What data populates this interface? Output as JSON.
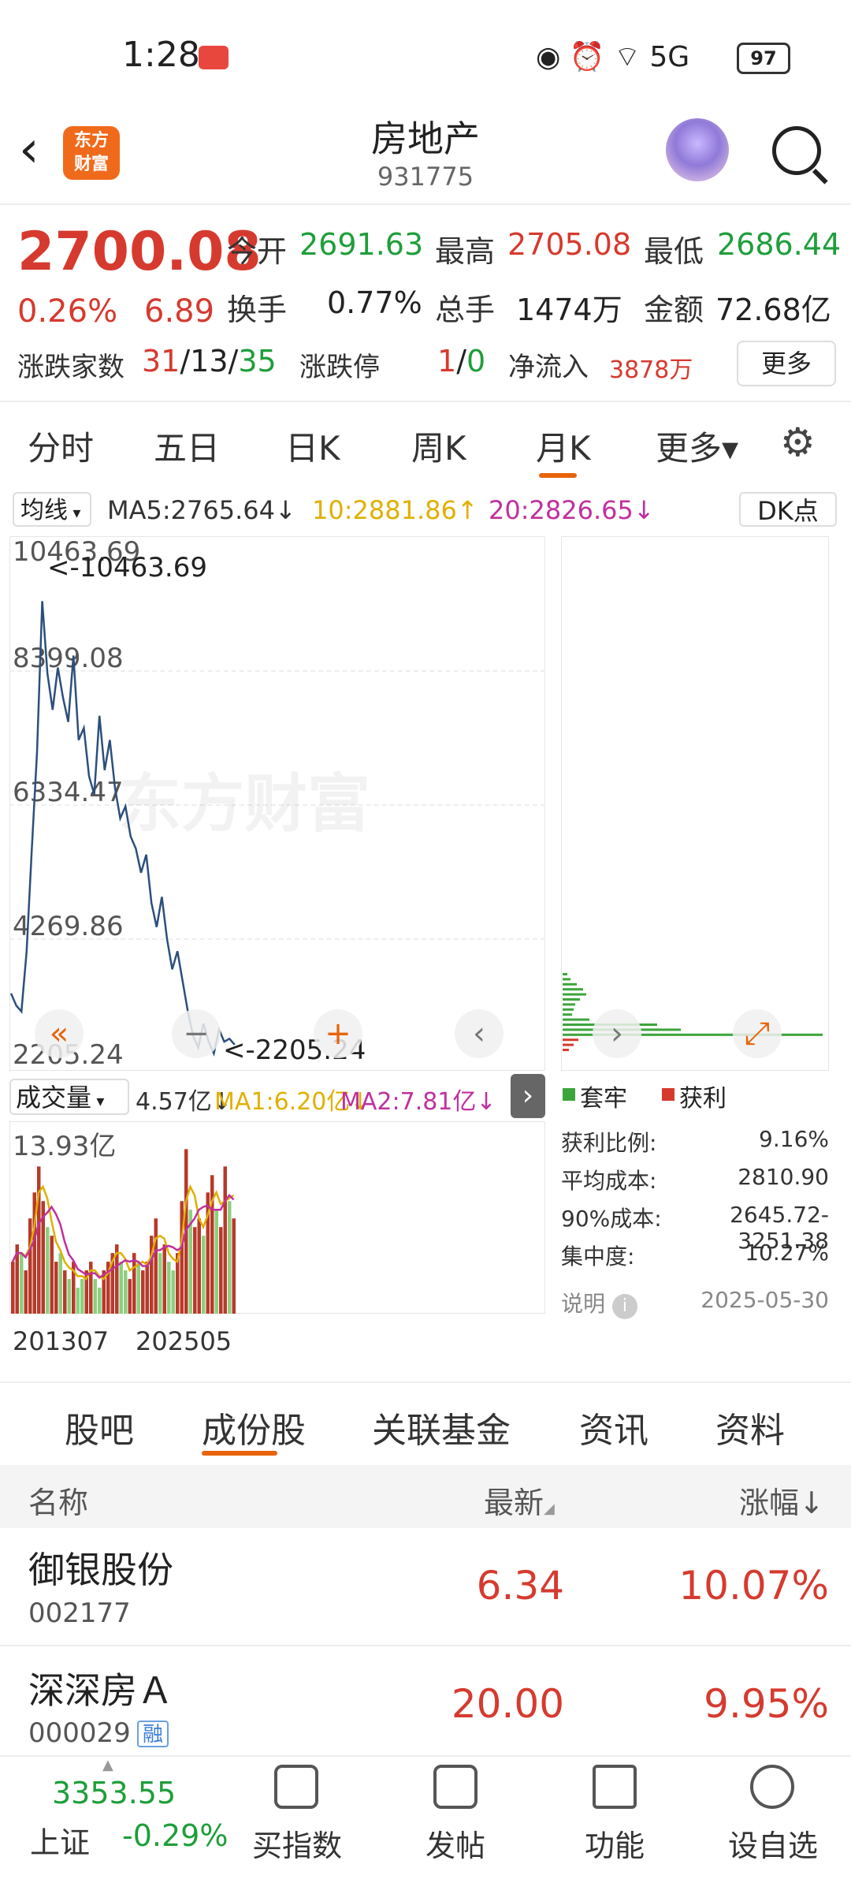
{
  "status_bar": {
    "time": "1:28",
    "battery": "97",
    "icons": "◉ ⏰ ⌔ 5G"
  },
  "header": {
    "title": "房地产",
    "code": "931775",
    "logo_text_1": "东方",
    "logo_text_2": "财富"
  },
  "quote": {
    "price": "2700.08",
    "change_pct": "0.26%",
    "change_abs": "6.89",
    "open_label": "今开",
    "open": "2691.63",
    "high_label": "最高",
    "high": "2705.08",
    "low_label": "最低",
    "low": "2686.44",
    "turnover_label": "换手",
    "turnover": "0.77%",
    "volume_label": "总手",
    "volume": "1474万",
    "amount_label": "金额",
    "amount": "72.68亿",
    "breadth_label": "涨跌家数",
    "breadth_up": "31",
    "breadth_sep1": "/",
    "breadth_flat": "13",
    "breadth_sep2": "/",
    "breadth_down": "35",
    "limit_label": "涨跌停",
    "limit_up": "1",
    "limit_sep": "/",
    "limit_down": "0",
    "netflow_label": "净流入",
    "netflow": "3878万",
    "more": "更多"
  },
  "chart_tabs": [
    "分时",
    "五日",
    "日K",
    "周K",
    "月K",
    "更多▾"
  ],
  "ma_bar": {
    "select": "均线",
    "ma5": "MA5:2765.64↓",
    "ma10": "10:2881.86↑",
    "ma20": "20:2826.65↓",
    "dk": "DK点"
  },
  "main_chart": {
    "y_labels": [
      "10463.69",
      "8399.08",
      "6334.47",
      "4269.86",
      "2205.24"
    ],
    "max_marker": "<-10463.69",
    "min_marker": "<-2205.24",
    "watermark": "东方财富"
  },
  "chart_data": {
    "type": "line",
    "title": "",
    "ylim": [
      2205.24,
      10463.69
    ],
    "values": [
      3200,
      3000,
      2900,
      3900,
      5600,
      7200,
      9700,
      8500,
      7900,
      8600,
      8100,
      7700,
      8800,
      7400,
      7600,
      6800,
      6500,
      7800,
      6900,
      7400,
      6600,
      6100,
      6300,
      5800,
      5600,
      5200,
      5500,
      4700,
      4300,
      4800,
      4100,
      3600,
      3900,
      3400,
      2900,
      2500,
      2300,
      2700,
      2400,
      2205.24,
      2600,
      2400,
      2450,
      2350
    ],
    "colors": {
      "line": "#2c4f7c"
    }
  },
  "volume": {
    "select": "成交量",
    "current": "4.57亿↓",
    "ma1": "MA1:6.20亿↓",
    "ma2": "MA2:7.81亿↓",
    "max_label": "13.93亿",
    "x_labels": [
      "201307",
      "202505"
    ],
    "bars": [
      0.3,
      0.4,
      0.35,
      0.25,
      0.55,
      0.7,
      0.85,
      0.65,
      0.5,
      0.45,
      0.3,
      0.35,
      0.25,
      0.2,
      0.3,
      0.15,
      0.2,
      0.25,
      0.3,
      0.2,
      0.15,
      0.25,
      0.3,
      0.35,
      0.4,
      0.3,
      0.25,
      0.2,
      0.35,
      0.3,
      0.25,
      0.3,
      0.45,
      0.55,
      0.35,
      0.4,
      0.3,
      0.25,
      0.35,
      0.65,
      0.95,
      0.6,
      0.5,
      0.55,
      0.45,
      0.7,
      0.8,
      0.6,
      0.5,
      0.85,
      0.65,
      0.55
    ],
    "bar_colors": [
      "r",
      "r",
      "g",
      "r",
      "r",
      "r",
      "r",
      "r",
      "g",
      "r",
      "r",
      "g",
      "r",
      "g",
      "r",
      "g",
      "g",
      "r",
      "r",
      "g",
      "g",
      "r",
      "r",
      "r",
      "r",
      "g",
      "g",
      "r",
      "r",
      "g",
      "r",
      "r",
      "r",
      "r",
      "g",
      "r",
      "g",
      "g",
      "r",
      "r",
      "r",
      "g",
      "r",
      "r",
      "g",
      "r",
      "r",
      "g",
      "r",
      "r",
      "g",
      "r"
    ]
  },
  "chip": {
    "legend_trap": "套牢",
    "legend_profit": "获利",
    "stats": [
      {
        "label": "获利比例:",
        "value": "9.16%"
      },
      {
        "label": "平均成本:",
        "value": "2810.90"
      },
      {
        "label": "90%成本:",
        "value": "2645.72-3251.38"
      },
      {
        "label": "集中度:",
        "value": "10.27%"
      }
    ],
    "note_label": "说明",
    "date": "2025-05-30",
    "colors": {
      "trap": "#3ba53b",
      "profit": "#d63a2f"
    }
  },
  "section_tabs": [
    "股吧",
    "成份股",
    "关联基金",
    "资讯",
    "资料"
  ],
  "list": {
    "headers": {
      "name": "名称",
      "latest": "最新",
      "change": "涨幅↓"
    },
    "rows": [
      {
        "name": "御银股份",
        "code": "002177",
        "latest": "6.34",
        "change": "10.07%",
        "badge": ""
      },
      {
        "name": "深深房Ａ",
        "code": "000029",
        "latest": "20.00",
        "change": "9.95%",
        "badge": "融"
      }
    ]
  },
  "bottom_nav": {
    "index_value": "3353.55",
    "index_name": "上证",
    "index_change": "-0.29%",
    "items": [
      "买指数",
      "发帖",
      "功能",
      "设自选"
    ]
  }
}
